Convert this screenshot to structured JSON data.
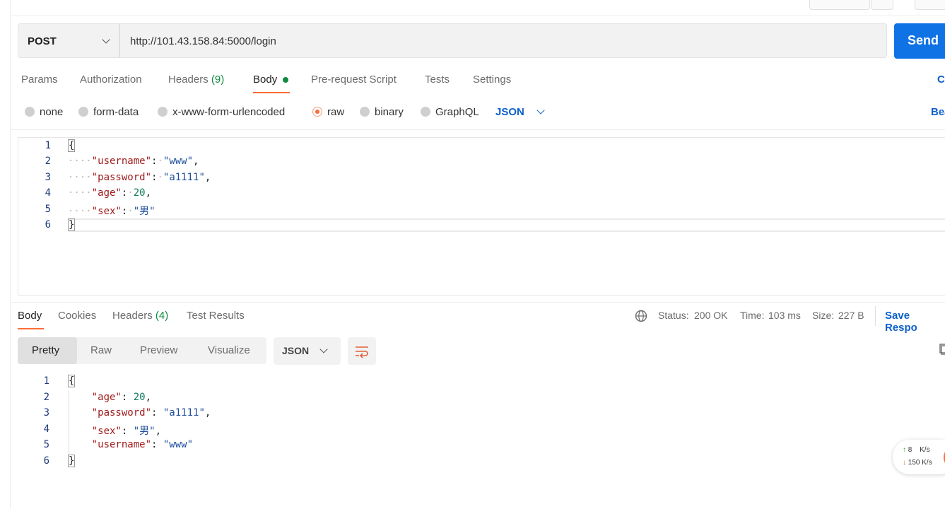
{
  "request": {
    "method": "POST",
    "url": "http://101.43.158.84:5000/login",
    "send_label": "Send",
    "tabs": [
      {
        "label": "Params"
      },
      {
        "label": "Authorization"
      },
      {
        "label": "Headers",
        "count": "(9)"
      },
      {
        "label": "Body"
      },
      {
        "label": "Pre-request Script"
      },
      {
        "label": "Tests"
      },
      {
        "label": "Settings"
      }
    ],
    "cookies_partial": "C",
    "body_types": [
      "none",
      "form-data",
      "x-www-form-urlencoded",
      "raw",
      "binary",
      "GraphQL"
    ],
    "body_format": "JSON",
    "beautify_partial": "Bea",
    "lines": [
      "1",
      "2",
      "3",
      "4",
      "5",
      "6"
    ],
    "code": {
      "open": "{",
      "close": "}",
      "k_username": "\"username\"",
      "v_username": "\"www\"",
      "k_password": "\"password\"",
      "v_password": "\"a1111\"",
      "k_age": "\"age\"",
      "v_age": "20",
      "k_sex": "\"sex\"",
      "v_sex": "\"男\""
    }
  },
  "response": {
    "tabs": [
      {
        "label": "Body"
      },
      {
        "label": "Cookies"
      },
      {
        "label": "Headers",
        "count": "(4)"
      },
      {
        "label": "Test Results"
      }
    ],
    "status_label": "Status:",
    "status_value": "200 OK",
    "time_label": "Time:",
    "time_value": "103 ms",
    "size_label": "Size:",
    "size_value": "227 B",
    "save_label": "Save Respo",
    "formats": [
      "Pretty",
      "Raw",
      "Preview",
      "Visualize"
    ],
    "format_select": "JSON",
    "lines": [
      "1",
      "2",
      "3",
      "4",
      "5",
      "6"
    ],
    "code": {
      "open": "{",
      "close": "}",
      "k_age": "\"age\"",
      "v_age": "20",
      "k_password": "\"password\"",
      "v_password": "\"a1111\"",
      "k_sex": "\"sex\"",
      "v_sex": "\"男\"",
      "k_username": "\"username\"",
      "v_username": "\"www\""
    }
  },
  "speed": {
    "up": "8",
    "up_unit": "K/s",
    "down": "150 K/s"
  },
  "colors": {
    "accent": "#ff6c37",
    "send": "#0f72e5",
    "success": "#0f8b3e",
    "link": "#0b5fcc"
  }
}
